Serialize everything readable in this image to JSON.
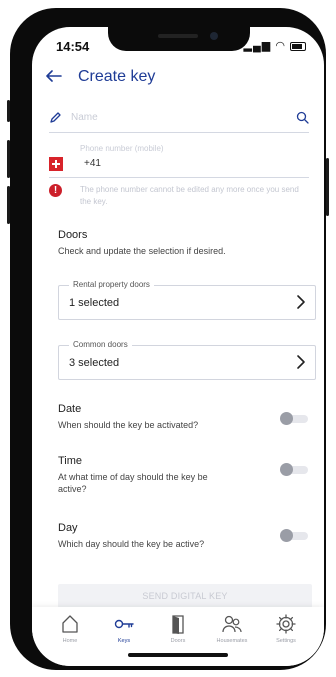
{
  "status": {
    "time": "14:54"
  },
  "header": {
    "title": "Create key"
  },
  "name_field": {
    "placeholder": "Name"
  },
  "phone_field": {
    "label": "Phone number (mobile)",
    "prefix": "+41"
  },
  "warning": {
    "text": "The phone number cannot be edited any more once you send the key."
  },
  "doors": {
    "title": "Doors",
    "subtitle": "Check and update the selection if desired.",
    "rental": {
      "legend": "Rental property doors",
      "value": "1 selected"
    },
    "common": {
      "legend": "Common doors",
      "value": "3 selected"
    }
  },
  "date": {
    "title": "Date",
    "subtitle": "When should the key be activated?",
    "enabled": false
  },
  "time": {
    "title": "Time",
    "subtitle": "At what time of day should the key be active?",
    "enabled": false
  },
  "day": {
    "title": "Day",
    "subtitle": "Which day should the key be active?",
    "enabled": false
  },
  "send_button": {
    "label": "SEND DIGITAL KEY"
  },
  "nav": {
    "items": [
      {
        "label": "Home",
        "icon": "home-icon",
        "active": false
      },
      {
        "label": "Keys",
        "icon": "key-icon",
        "active": true
      },
      {
        "label": "Doors",
        "icon": "door-icon",
        "active": false
      },
      {
        "label": "Housemates",
        "icon": "people-icon",
        "active": false
      },
      {
        "label": "Settings",
        "icon": "gear-icon",
        "active": false
      }
    ]
  },
  "colors": {
    "accent": "#1f3c96",
    "error": "#cc1f2a",
    "flag": "#d8232a"
  }
}
